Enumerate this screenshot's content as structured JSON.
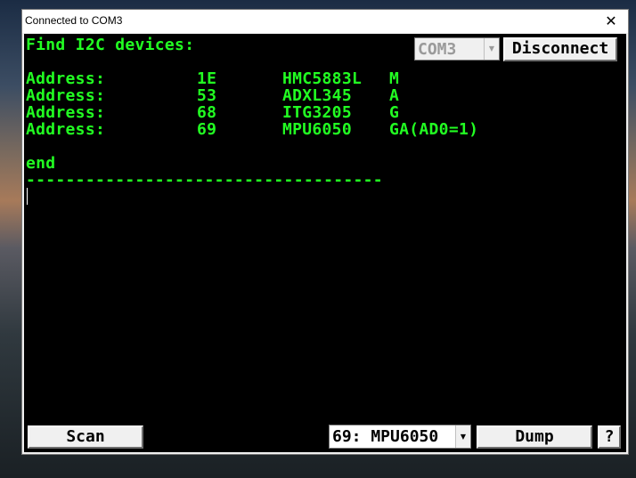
{
  "window": {
    "title": "Connected to COM3",
    "close_glyph": "✕"
  },
  "terminal": {
    "heading": "Find I2C devices:",
    "rows": [
      {
        "label": "Address:",
        "address": "1E",
        "device": "HMC5883L",
        "type": "M"
      },
      {
        "label": "Address:",
        "address": "53",
        "device": "ADXL345",
        "type": "A"
      },
      {
        "label": "Address:",
        "address": "68",
        "device": "ITG3205",
        "type": "G"
      },
      {
        "label": "Address:",
        "address": "69",
        "device": "MPU6050",
        "type": "GA(AD0=1)"
      }
    ],
    "footer": "end",
    "separator": "------------------------------------"
  },
  "controls": {
    "port_select": {
      "value": "COM3"
    },
    "disconnect_label": "Disconnect",
    "scan_label": "Scan",
    "device_select": {
      "value": "69: MPU6050"
    },
    "dump_label": "Dump",
    "help_label": "?",
    "dropdown_glyph": "▼"
  }
}
